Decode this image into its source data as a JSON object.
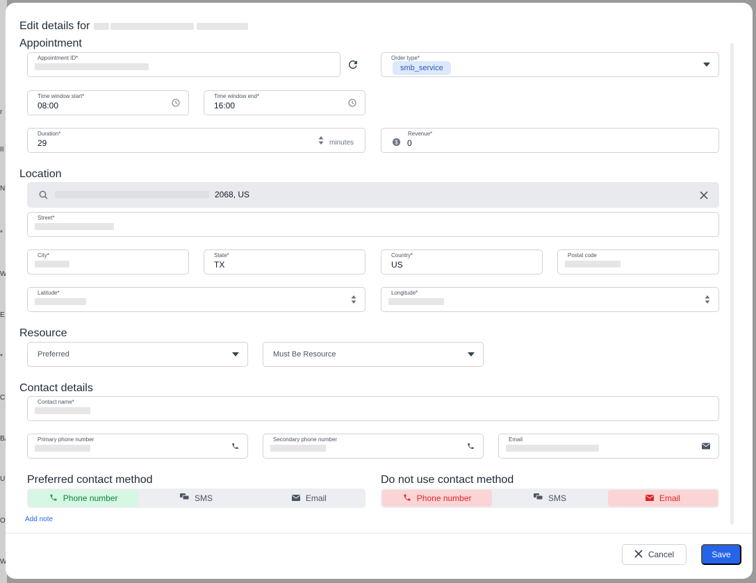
{
  "dialog": {
    "title": "Edit details for",
    "cancel_label": "Cancel",
    "save_label": "Save"
  },
  "appointment": {
    "section_title": "Appointment",
    "appointment_id_label": "Appointment ID*",
    "order_type_label": "Order type*",
    "order_type_value": "smb_service",
    "time_start_label": "Time window start*",
    "time_start_value": "08:00",
    "time_end_label": "Time window end*",
    "time_end_value": "16:00",
    "duration_label": "Duration*",
    "duration_value": "29",
    "duration_unit": "minutes",
    "revenue_label": "Revenue*",
    "revenue_value": "0"
  },
  "location": {
    "section_title": "Location",
    "search_value": "2068, US",
    "street_label": "Street*",
    "city_label": "City*",
    "state_label": "State*",
    "state_value": "TX",
    "country_label": "Country*",
    "country_value": "US",
    "postal_label": "Postal code",
    "latitude_label": "Latitude*",
    "longitude_label": "Longitude*"
  },
  "resource": {
    "section_title": "Resource",
    "preferred_placeholder": "Preferred",
    "must_be_placeholder": "Must Be Resource"
  },
  "contact": {
    "section_title": "Contact details",
    "name_label": "Contact name*",
    "primary_phone_label": "Primary phone number",
    "secondary_phone_label": "Secondary phone number",
    "email_label": "Email",
    "preferred_title": "Preferred contact method",
    "do_not_use_title": "Do not use contact method",
    "methods": [
      "Phone number",
      "SMS",
      "Email"
    ],
    "add_note": "Add note"
  },
  "background": {
    "edge_letters": [
      "r",
      "II",
      "NE",
      "*",
      "W",
      "E",
      "*",
      "C",
      "BA",
      "UE",
      "OC",
      "W"
    ]
  },
  "colors": {
    "accent": "#2563eb",
    "selected_green": "#d5f7e3",
    "blocked_red": "#fbd5d5"
  }
}
